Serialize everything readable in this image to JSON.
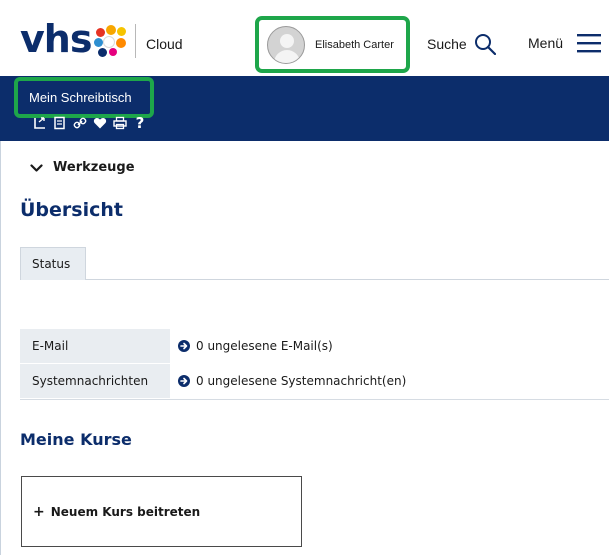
{
  "brand": {
    "logo_text": "vhs",
    "product": "Cloud"
  },
  "header": {
    "user_name": "Elisabeth Carter",
    "search_label": "Suche",
    "menu_label": "Menü"
  },
  "desk": {
    "title": "Mein Schreibtisch"
  },
  "toolbar": {
    "help_glyph": "?"
  },
  "tools": {
    "label": "Werkzeuge"
  },
  "overview": {
    "title": "Übersicht",
    "tabs": [
      {
        "label": "Status"
      }
    ],
    "rows": [
      {
        "label": "E-Mail",
        "value": "0 ungelesene E-Mail(s)"
      },
      {
        "label": "Systemnachrichten",
        "value": "0 ungelesene Systemnachricht(en)"
      }
    ]
  },
  "courses": {
    "title": "Meine Kurse",
    "join_plus": "+",
    "join_label": "Neuem Kurs beitreten"
  },
  "colors": {
    "brand_navy": "#0c2d6b",
    "highlight_green": "#1ea64a",
    "label_cell_bg": "#e9edf1"
  }
}
